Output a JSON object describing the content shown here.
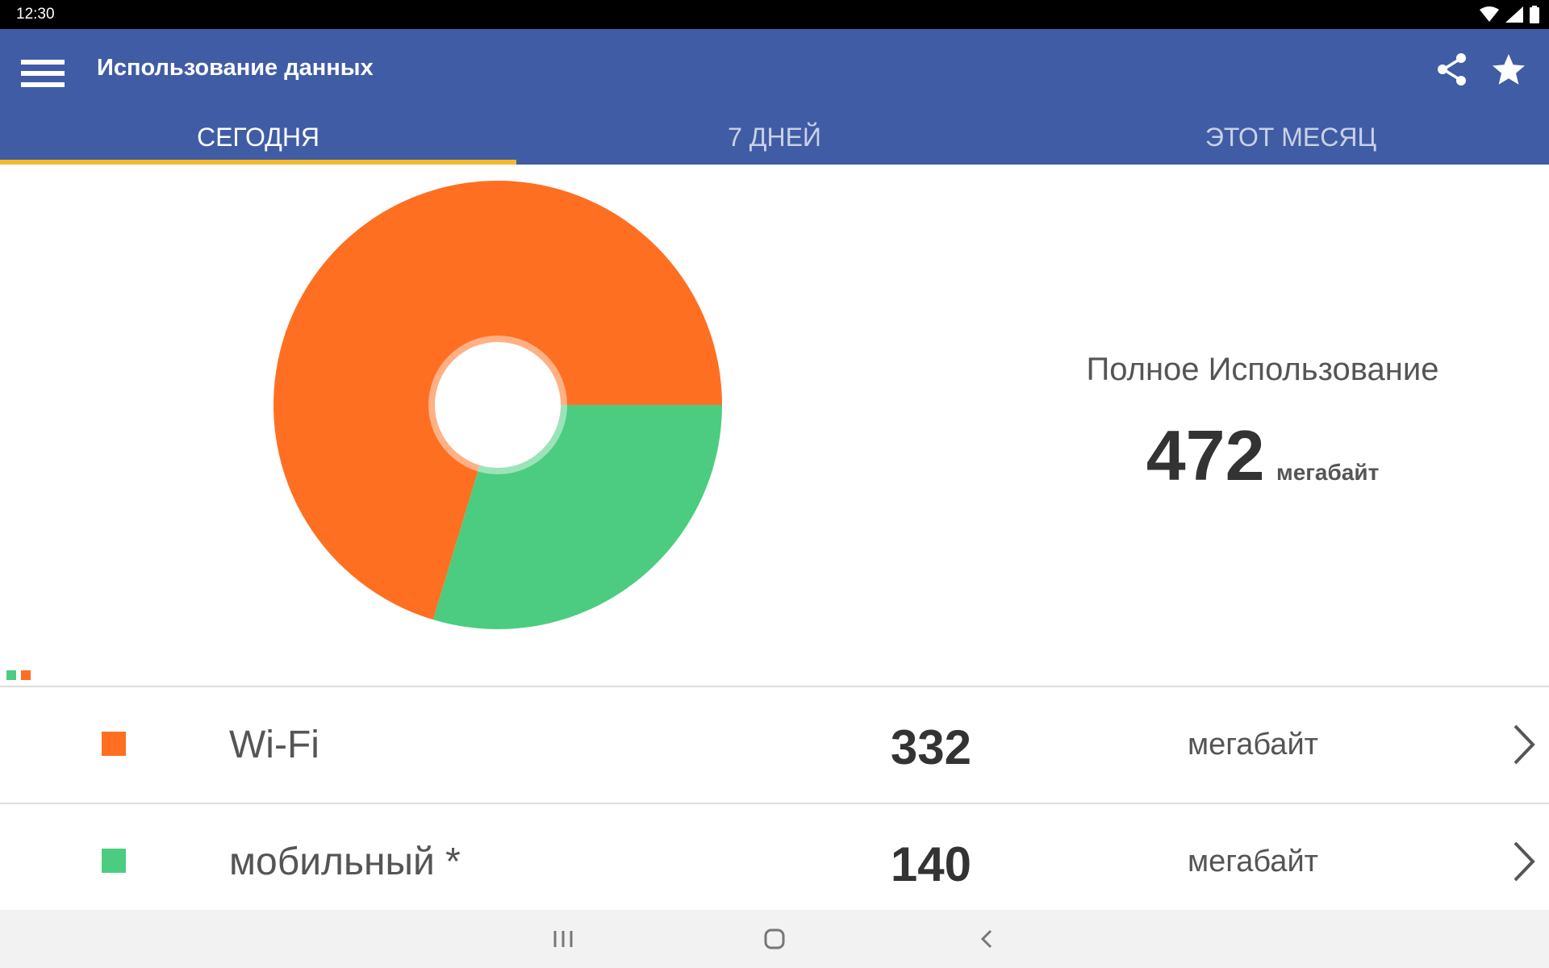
{
  "status_bar": {
    "time": "12:30"
  },
  "app_bar": {
    "title": "Использование данных"
  },
  "tabs": [
    {
      "label": "СЕГОДНЯ",
      "active": true
    },
    {
      "label": "7 ДНЕЙ",
      "active": false
    },
    {
      "label": "ЭТОТ МЕСЯЦ",
      "active": false
    }
  ],
  "summary": {
    "label": "Полное Использование",
    "value": "472",
    "unit": "мегабайт"
  },
  "usage": [
    {
      "name": "Wi-Fi",
      "value": "332",
      "unit": "мегабайт",
      "color": "#ff6f22"
    },
    {
      "name": "мобильный *",
      "value": "140",
      "unit": "мегабайт",
      "color": "#4ccc80"
    }
  ],
  "chart_data": {
    "type": "pie",
    "categories": [
      "Wi-Fi",
      "мобильный *"
    ],
    "values": [
      332,
      140
    ],
    "colors": [
      "#ff6f22",
      "#4ccc80"
    ],
    "donut": true
  },
  "icons": {
    "menu": "menu-icon",
    "share": "share-icon",
    "star": "star-icon",
    "row_action": "chevron-right-icon",
    "nav": [
      "recent-apps-icon",
      "home-icon",
      "back-icon"
    ]
  },
  "colors": {
    "app_bar": "#405ca5",
    "tab_indicator": "#f5b82e",
    "status_bar": "#000000",
    "nav_bar": "#f2f2f2"
  }
}
